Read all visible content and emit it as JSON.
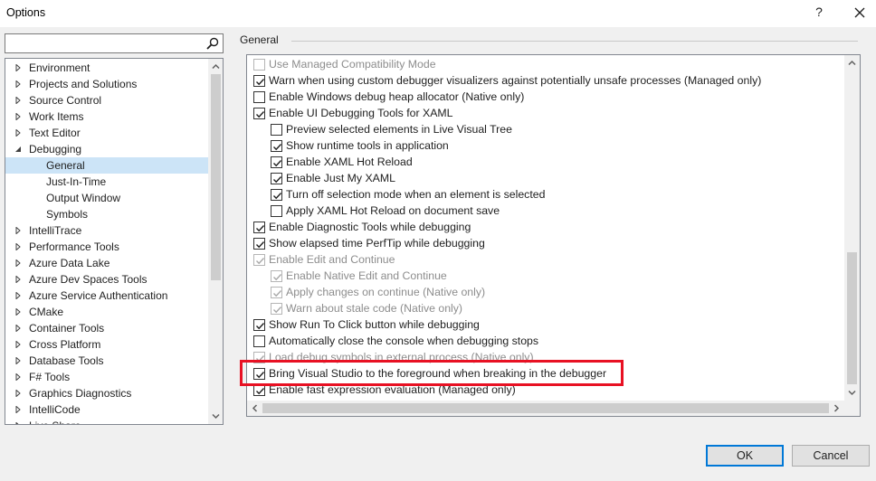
{
  "window": {
    "title": "Options",
    "help_label": "?"
  },
  "search": {
    "placeholder": ""
  },
  "tree": {
    "items": [
      {
        "label": "Environment"
      },
      {
        "label": "Projects and Solutions"
      },
      {
        "label": "Source Control"
      },
      {
        "label": "Work Items"
      },
      {
        "label": "Text Editor"
      },
      {
        "label": "Debugging"
      },
      {
        "label": "General"
      },
      {
        "label": "Just-In-Time"
      },
      {
        "label": "Output Window"
      },
      {
        "label": "Symbols"
      },
      {
        "label": "IntelliTrace"
      },
      {
        "label": "Performance Tools"
      },
      {
        "label": "Azure Data Lake"
      },
      {
        "label": "Azure Dev Spaces Tools"
      },
      {
        "label": "Azure Service Authentication"
      },
      {
        "label": "CMake"
      },
      {
        "label": "Container Tools"
      },
      {
        "label": "Cross Platform"
      },
      {
        "label": "Database Tools"
      },
      {
        "label": "F# Tools"
      },
      {
        "label": "Graphics Diagnostics"
      },
      {
        "label": "IntelliCode"
      },
      {
        "label": "Live Share"
      }
    ]
  },
  "section": {
    "title": "General"
  },
  "options": [
    {
      "label": "Use Managed Compatibility Mode",
      "checked": false,
      "disabled": true
    },
    {
      "label": "Warn when using custom debugger visualizers against potentially unsafe processes (Managed only)",
      "checked": true,
      "disabled": false
    },
    {
      "label": "Enable Windows debug heap allocator (Native only)",
      "checked": false,
      "disabled": false
    },
    {
      "label": "Enable UI Debugging Tools for XAML",
      "checked": true,
      "disabled": false
    },
    {
      "label": "Preview selected elements in Live Visual Tree",
      "checked": false,
      "disabled": false
    },
    {
      "label": "Show runtime tools in application",
      "checked": true,
      "disabled": false
    },
    {
      "label": "Enable XAML Hot Reload",
      "checked": true,
      "disabled": false
    },
    {
      "label": "Enable Just My XAML",
      "checked": true,
      "disabled": false
    },
    {
      "label": "Turn off selection mode when an element is selected",
      "checked": true,
      "disabled": false
    },
    {
      "label": "Apply XAML Hot Reload on document save",
      "checked": false,
      "disabled": false
    },
    {
      "label": "Enable Diagnostic Tools while debugging",
      "checked": true,
      "disabled": false
    },
    {
      "label": "Show elapsed time PerfTip while debugging",
      "checked": true,
      "disabled": false
    },
    {
      "label": "Enable Edit and Continue",
      "checked": true,
      "disabled": true
    },
    {
      "label": "Enable Native Edit and Continue",
      "checked": true,
      "disabled": true
    },
    {
      "label": "Apply changes on continue (Native only)",
      "checked": true,
      "disabled": true
    },
    {
      "label": "Warn about stale code (Native only)",
      "checked": true,
      "disabled": true
    },
    {
      "label": "Show Run To Click button while debugging",
      "checked": true,
      "disabled": false
    },
    {
      "label": "Automatically close the console when debugging stops",
      "checked": false,
      "disabled": false
    },
    {
      "label": "Load debug symbols in external process (Native only)",
      "checked": true,
      "disabled": true
    },
    {
      "label": "Bring Visual Studio to the foreground when breaking in the debugger",
      "checked": true,
      "disabled": false
    },
    {
      "label": "Enable fast expression evaluation (Managed only)",
      "checked": true,
      "disabled": false
    }
  ],
  "buttons": {
    "ok": "OK",
    "cancel": "Cancel"
  },
  "colors": {
    "highlight": "#e81123",
    "selection": "#cce4f7",
    "ok_border": "#0078d7"
  }
}
